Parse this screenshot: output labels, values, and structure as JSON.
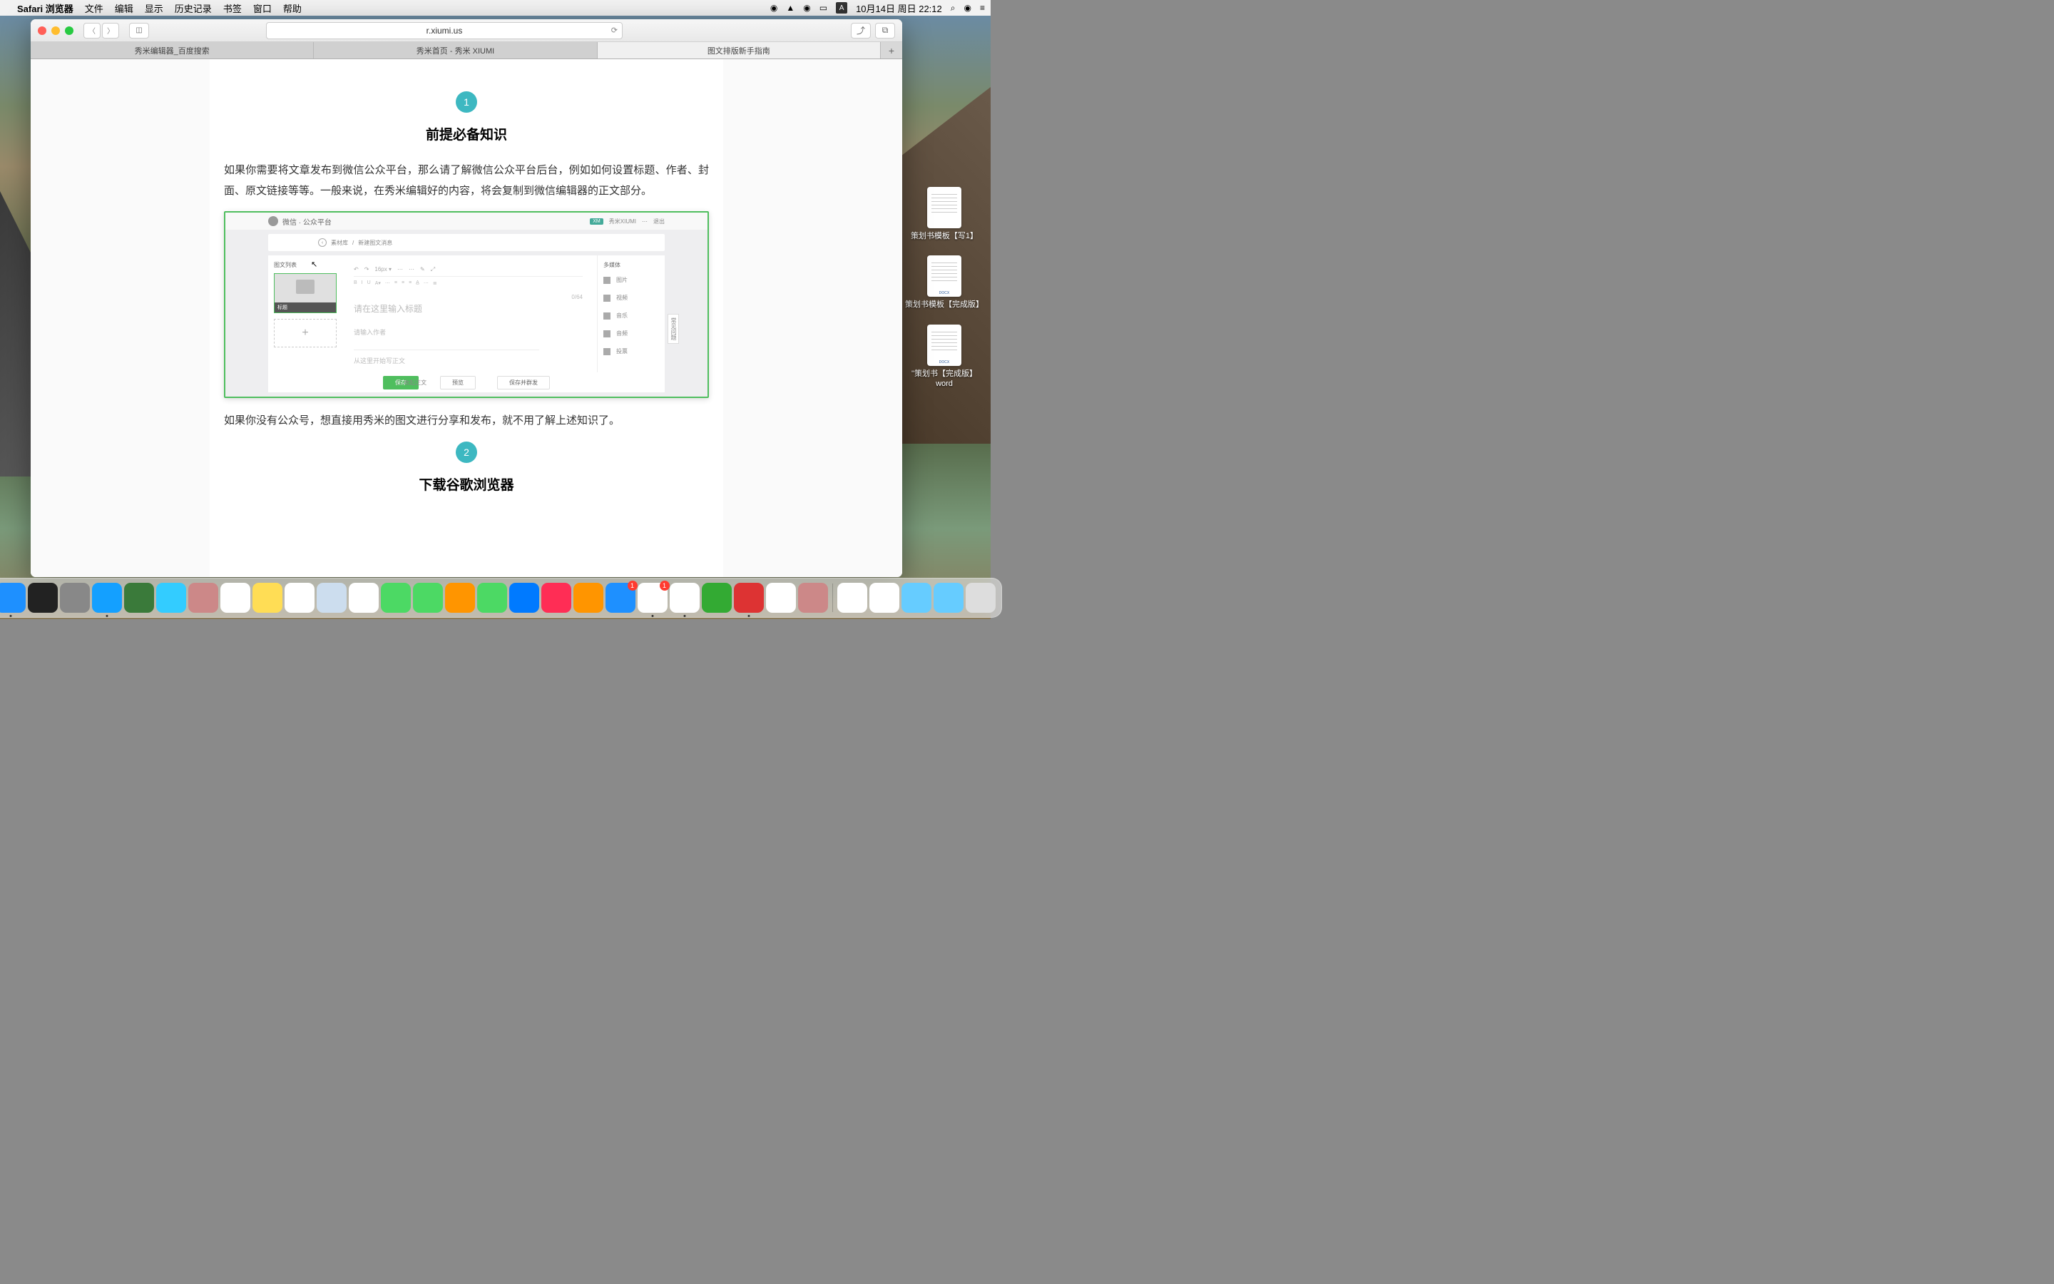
{
  "menubar": {
    "app": "Safari 浏览器",
    "items": [
      "文件",
      "编辑",
      "显示",
      "历史记录",
      "书签",
      "窗口",
      "帮助"
    ],
    "datetime": "10月14日 周日 22:12",
    "ime": "A"
  },
  "safari": {
    "url": "r.xiumi.us",
    "tabs": [
      "秀米编辑器_百度搜索",
      "秀米首页 - 秀米 XIUMI",
      "图文排版新手指南"
    ],
    "active_tab": 2
  },
  "article": {
    "step1": {
      "num": "1",
      "title": "前提必备知识"
    },
    "p1": "如果你需要将文章发布到微信公众平台，那么请了解微信公众平台后台，例如如何设置标题、作者、封面、原文链接等等。一般来说，在秀米编辑好的内容，将会复制到微信编辑器的正文部分。",
    "p2": "如果你没有公众号，想直接用秀米的图文进行分享和发布，就不用了解上述知识了。",
    "step2": {
      "num": "2",
      "title": "下载谷歌浏览器"
    }
  },
  "wx": {
    "brand": "微信 · 公众平台",
    "header_right": {
      "xiumi": "秀米XIUMI",
      "logout": "退出",
      "other": "⋯"
    },
    "crumb": {
      "back_label": "素材库",
      "current": "新建图文消息"
    },
    "left_title": "图文列表",
    "thumb_label": "标题",
    "title_ph": "请在这里输入标题",
    "title_count": "0/64",
    "author_ph": "请输入作者",
    "body_ph": "从这里开始写正文",
    "right_title": "多媒体",
    "media": [
      "图片",
      "视频",
      "音乐",
      "音频",
      "投票"
    ],
    "side_tab": "常见问题",
    "footer": {
      "collapse": "收起正文",
      "save": "保存",
      "preview": "预览",
      "save_send": "保存并群发"
    }
  },
  "desktop_files": [
    {
      "name": "策划书模板【写1】"
    },
    {
      "name": "策划书模板【完成版】"
    },
    {
      "name": "\"策划书【完成版】word"
    }
  ],
  "dock": {
    "apps": [
      {
        "name": "finder",
        "color": "#1e90ff",
        "running": true
      },
      {
        "name": "siri",
        "color": "#222",
        "running": false
      },
      {
        "name": "launchpad",
        "color": "#888",
        "running": false
      },
      {
        "name": "safari",
        "color": "#14a0ff",
        "running": true
      },
      {
        "name": "qgis",
        "color": "#3a7a3a",
        "running": false
      },
      {
        "name": "mail",
        "color": "#3cf",
        "running": false
      },
      {
        "name": "contacts",
        "color": "#c88",
        "running": false
      },
      {
        "name": "calendar",
        "color": "#fff",
        "running": false
      },
      {
        "name": "notes",
        "color": "#ffdd55",
        "running": false
      },
      {
        "name": "reminders",
        "color": "#fff",
        "running": false
      },
      {
        "name": "maps",
        "color": "#cde",
        "running": false
      },
      {
        "name": "photos",
        "color": "#fff",
        "running": false
      },
      {
        "name": "messages",
        "color": "#4cd964",
        "running": false
      },
      {
        "name": "facetime",
        "color": "#4cd964",
        "running": false
      },
      {
        "name": "pages",
        "color": "#ff9500",
        "running": false
      },
      {
        "name": "numbers",
        "color": "#4cd964",
        "running": false
      },
      {
        "name": "keynote",
        "color": "#007aff",
        "running": false
      },
      {
        "name": "itunes",
        "color": "#ff2d55",
        "running": false
      },
      {
        "name": "ibooks",
        "color": "#ff9500",
        "running": false
      },
      {
        "name": "appstore",
        "color": "#1e90ff",
        "running": false,
        "badge": "1"
      },
      {
        "name": "wechat",
        "color": "#fff",
        "running": true,
        "badge": "1"
      },
      {
        "name": "qq",
        "color": "#fff",
        "running": true
      },
      {
        "name": "iqiyi",
        "color": "#3a3",
        "running": false
      },
      {
        "name": "netease",
        "color": "#d33",
        "running": true
      },
      {
        "name": "chrome",
        "color": "#fff",
        "running": false
      },
      {
        "name": "profile",
        "color": "#c88",
        "running": false
      }
    ],
    "right": [
      {
        "name": "doc",
        "color": "#fff"
      },
      {
        "name": "doc2",
        "color": "#fff"
      },
      {
        "name": "folder",
        "color": "#6cf"
      },
      {
        "name": "folder2",
        "color": "#6cf"
      },
      {
        "name": "trash",
        "color": "#ddd"
      }
    ]
  }
}
